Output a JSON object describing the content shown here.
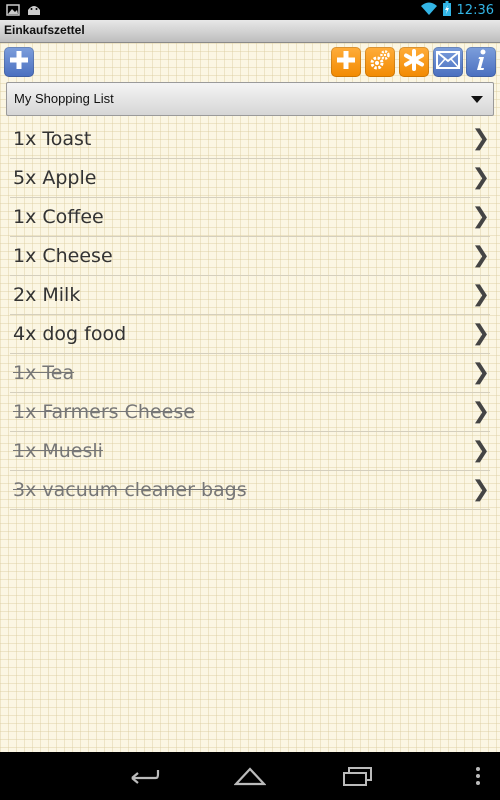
{
  "status_bar": {
    "time": "12:36",
    "icons": [
      "image-icon",
      "android-icon",
      "wifi-icon",
      "battery-icon"
    ]
  },
  "app": {
    "title": "Einkaufszettel"
  },
  "toolbar": {
    "left_button": "add-list",
    "right_buttons": [
      "add-item",
      "settings",
      "star",
      "email",
      "info"
    ]
  },
  "list_selector": {
    "selected": "My Shopping List"
  },
  "items": [
    {
      "label": "1x Toast",
      "done": false
    },
    {
      "label": "5x Apple",
      "done": false
    },
    {
      "label": "1x Coffee",
      "done": false
    },
    {
      "label": "1x Cheese",
      "done": false
    },
    {
      "label": "2x Milk",
      "done": false
    },
    {
      "label": "4x dog food",
      "done": false
    },
    {
      "label": "1x Tea",
      "done": true
    },
    {
      "label": "1x Farmers Cheese",
      "done": true
    },
    {
      "label": "1x Muesli",
      "done": true
    },
    {
      "label": "3x vacuum cleaner bags",
      "done": true
    }
  ],
  "chevron": "❯",
  "colors": {
    "accent_blue": "#4a6fbf",
    "accent_orange": "#f28a00",
    "clock": "#33b5e5",
    "paper": "#fbf6e3"
  }
}
